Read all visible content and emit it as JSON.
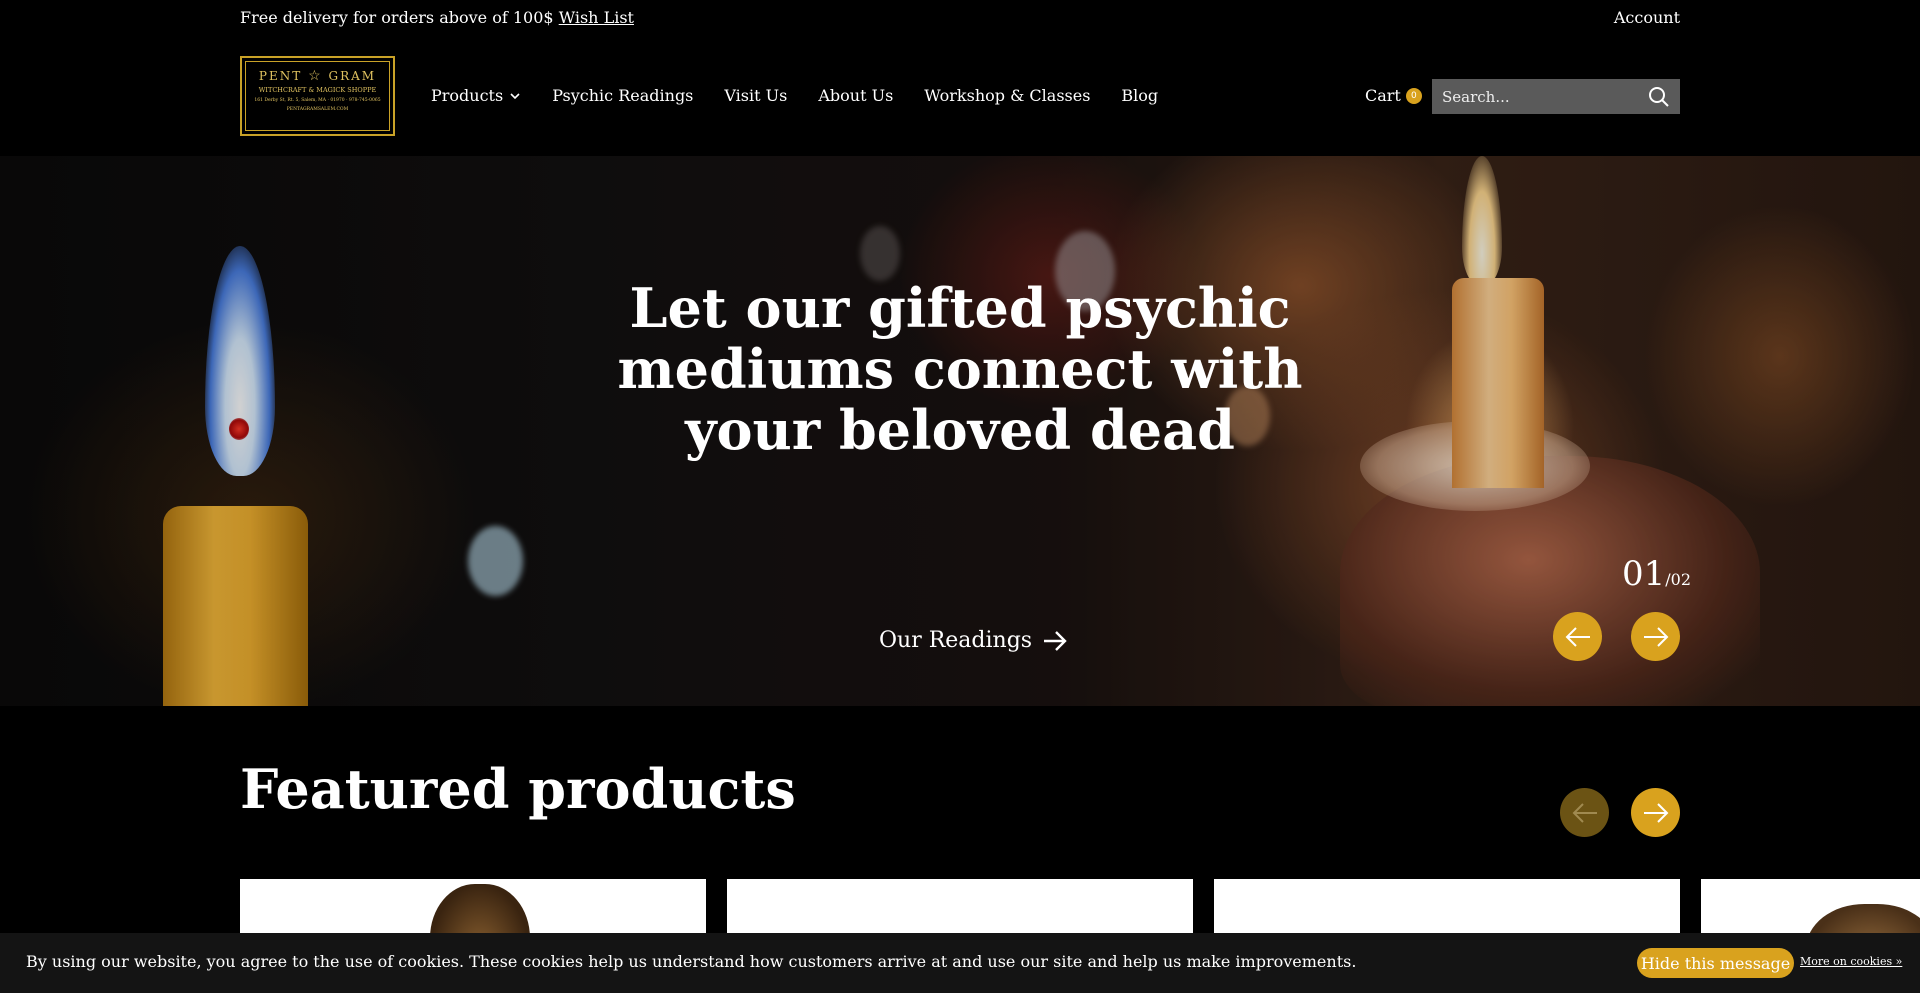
{
  "topbar": {
    "promo_text": "Free delivery for orders above of 100$",
    "wishlist_link": "Wish List",
    "account_link": "Account"
  },
  "logo": {
    "title_left": "PENT",
    "title_right": "GRAM",
    "subtitle": "WITCHCRAFT & MAGICK SHOPPE",
    "address": "161 Derby St, Rt. 5, Salem, MA · 01970 · 978-745-0065",
    "website": "PENTAGRAMSALEM.COM"
  },
  "nav": {
    "items": [
      "Products",
      "Psychic Readings",
      "Visit Us",
      "About Us",
      "Workshop & Classes",
      "Blog"
    ]
  },
  "cart": {
    "label": "Cart",
    "count": "0"
  },
  "search": {
    "placeholder": "Search..."
  },
  "hero": {
    "title": "Let our gifted psychic mediums connect with your beloved dead",
    "cta_label": "Our Readings",
    "slide_current": "01",
    "slide_total": "/02"
  },
  "featured": {
    "title": "Featured products"
  },
  "cookie": {
    "message": "By using our website, you agree to the use of cookies. These cookies help us understand how customers arrive at and use our site and help us make improvements.",
    "hide_label": "Hide this message",
    "more_label": "More on cookies »"
  },
  "colors": {
    "accent": "#d9a21e",
    "background": "#000000",
    "search_bg": "#5a5a5a"
  },
  "icons": [
    "chevron-down-icon",
    "search-icon",
    "arrow-right-icon",
    "arrow-left-icon",
    "star-icon"
  ]
}
